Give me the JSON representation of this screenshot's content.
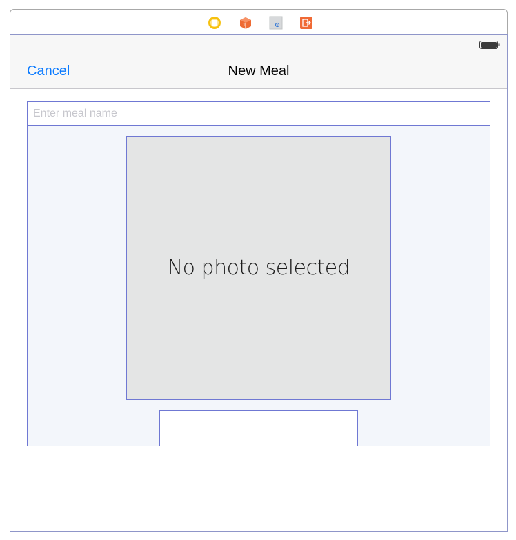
{
  "scene_dock": {
    "icons": [
      "view-controller-icon",
      "first-responder-icon",
      "storyboard-entry-icon",
      "exit-icon"
    ]
  },
  "status_bar": {
    "battery_icon": "battery-icon"
  },
  "nav_bar": {
    "cancel_label": "Cancel",
    "title": "New Meal"
  },
  "meal_name_field": {
    "placeholder": "Enter meal name",
    "value": ""
  },
  "photo": {
    "label": "No photo selected"
  },
  "colors": {
    "tint": "#0a7aff",
    "placeholder_bg": "#e4e5e5",
    "stack_bg": "#f3f6fb",
    "selection_outline": "#6f78d3"
  }
}
